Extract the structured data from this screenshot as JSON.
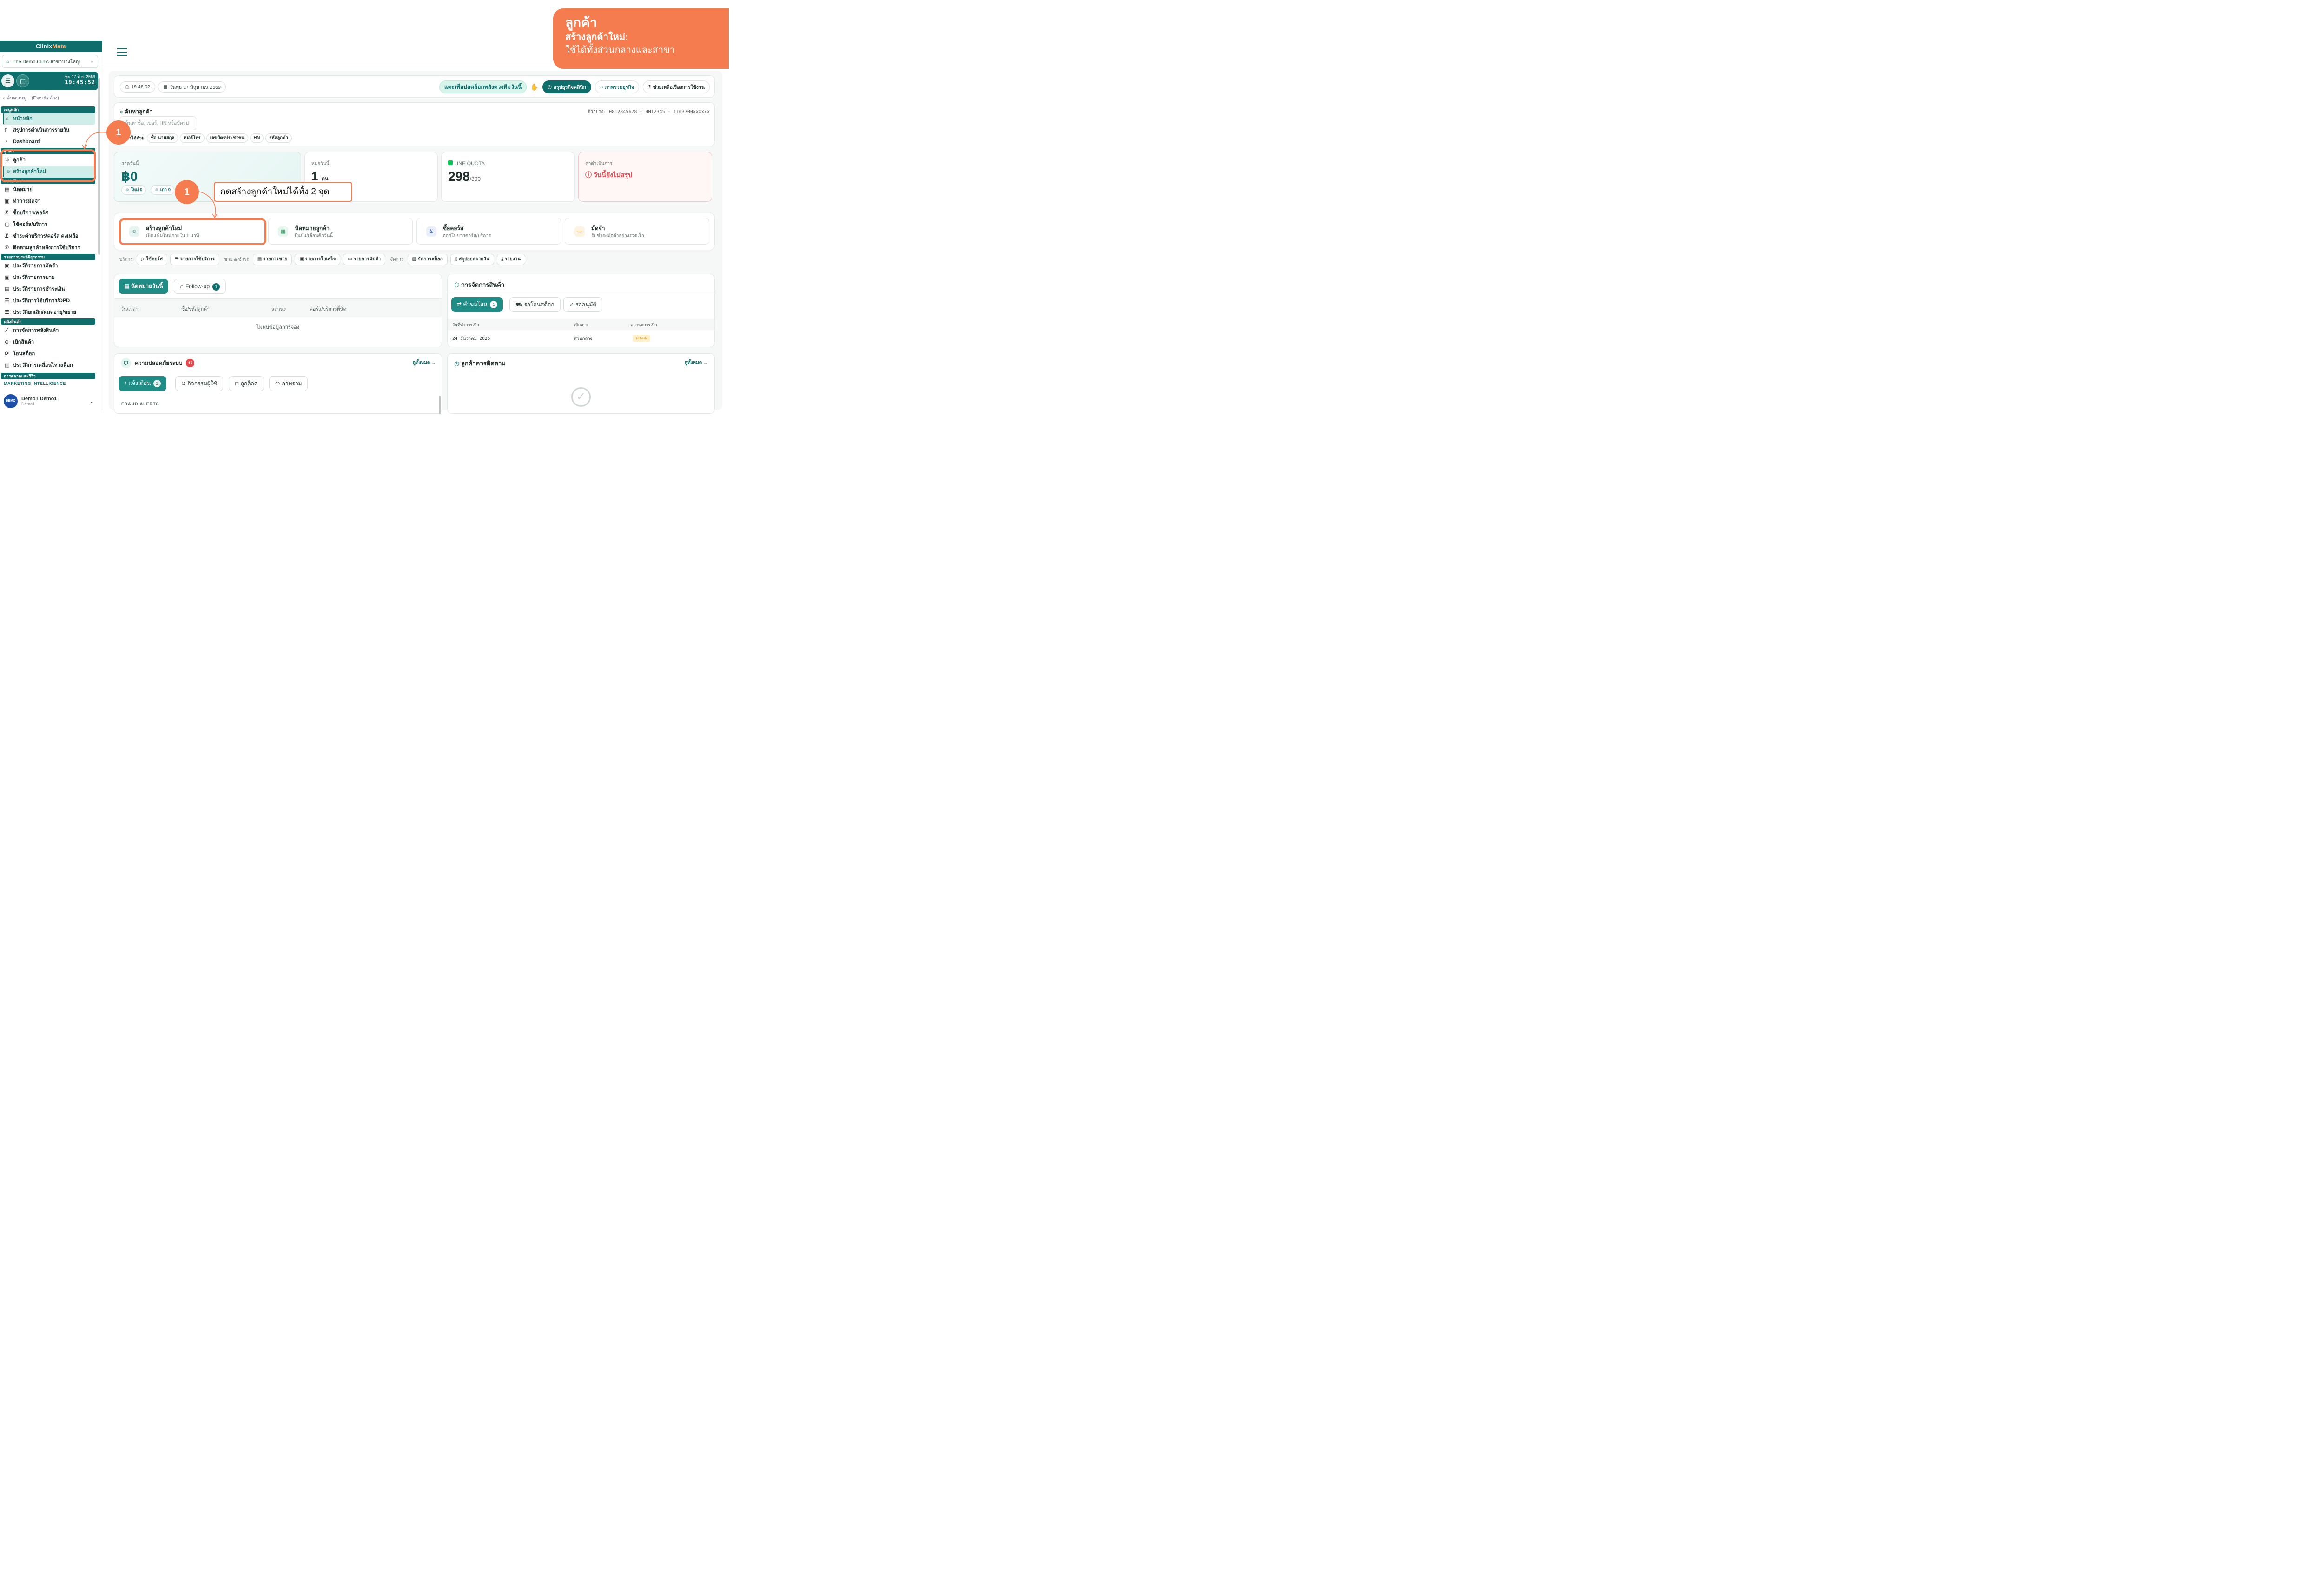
{
  "brand": {
    "part1": "Clinix",
    "part2": "Mate"
  },
  "clinic": {
    "name": "The Demo Clinic สาขาบางใหญ่"
  },
  "clock": {
    "date": "พุธ 17 มิ.ย. 2569",
    "time": "19:45:52"
  },
  "menu_search": {
    "placeholder": "ค้นหาเมนู... (Esc เพื่อล้าง)"
  },
  "sidebar": {
    "sections": {
      "main": "เมนูหลัก",
      "customer": "ลูกค้า",
      "service": "งานบริการ",
      "history": "รายการประวัติธุรกรรม",
      "stock": "คลังสินค้า",
      "marketing": "การตลาดและรีวิว",
      "intel": "MARKETING INTELLIGENCE"
    },
    "items": {
      "home": "หน้าหลัก",
      "daily_summary": "สรุปการดำเนินการรายวัน",
      "dashboard": "Dashboard",
      "customer": "ลูกค้า",
      "new_customer": "สร้างลูกค้าใหม่",
      "appointment": "นัดหมาย",
      "deposit": "ทำการมัดจำ",
      "buy_service": "ซื้อบริการ/คอร์ส",
      "use_course": "ใช้คอร์ส/บริการ",
      "pay_remaining": "ชำระค่าบริการ/คอร์ส คงเหลือ",
      "follow_up": "ติดตามลูกค้าหลังการใช้บริการ",
      "hist_deposit": "ประวัติรายการมัดจำ",
      "hist_sales": "ประวัติรายการขาย",
      "hist_payment": "ประวัติรายการชำระเงิน",
      "hist_opd": "ประวัติการใช้บริการ/OPD",
      "hist_cancel": "ประวัติยกเลิก/หมดอายุ/ขยาย",
      "stock_manage": "การจัดการคลังสินค้า",
      "withdraw": "เบิกสินค้า",
      "transfer": "โอนสต็อก",
      "stock_history": "ประวัติการเคลื่อนไหวสต็อก"
    }
  },
  "user": {
    "name": "Demo1 Demo1",
    "sub": "Demo1",
    "avatar": "DEMO"
  },
  "callout": {
    "title": "ลูกค้า",
    "subtitle": "สร้างลูกค้าใหม่:",
    "desc": "ใช้ได้ทั้งส่วนกลางและสาขา"
  },
  "topbar": {
    "time": "19:46:02",
    "date": "วันพุธ 17 มิถุนายน 2569",
    "energy": "แตะเพื่อปลดล็อกพลังดวงทีมวันนี้",
    "summary_btn": "สรุปธุรกิจคลินิก",
    "overview_btn": "ภาพรวมธุรกิจ",
    "help_btn": "ช่วยเหลือเรื่องการใช้งาน"
  },
  "customer_search": {
    "title": "ค้นหาลูกค้า",
    "example": "ตัวอย่าง: 0812345678 · HN12345 · 1103700xxxxxx",
    "placeholder": "ค้นหาชื่อ, เบอร์, HN หรือบัตรป",
    "by_label": "ค้นหาได้ด้วย",
    "chips": [
      "ชื่อ-นามสกุล",
      "เบอร์โทร",
      "เลขบัตรประชาชน",
      "HN",
      "รหัสลูกค้า"
    ]
  },
  "stats": {
    "sales_label": "ยอดวันนี้",
    "sales_value": "฿0",
    "new_label": "ใหม่",
    "new_value": "0",
    "old_label": "เก่า",
    "old_value": "0",
    "doctor_label": "หมอวันนี้",
    "doctor_value": "1",
    "doctor_unit": "คน",
    "line_label": "LINE QUOTA",
    "line_value": "298",
    "line_max": "/300",
    "expense_label": "ค่าดำเนินการ",
    "expense_value": "วันนี้ยังไม่สรุป"
  },
  "quick_actions": [
    {
      "title": "สร้างลูกค้าใหม่",
      "sub": "เปิดแฟ้มใหม่ภายใน 1 นาที"
    },
    {
      "title": "นัดหมายลูกค้า",
      "sub": "ยืนยัน/เลื่อนคิววันนี้"
    },
    {
      "title": "ซื้อคอร์ส",
      "sub": "ออกใบขายคอร์ส/บริการ"
    },
    {
      "title": "มัดจำ",
      "sub": "รับชำระมัดจำอย่างรวดเร็ว"
    }
  ],
  "service_bar": {
    "label_service": "บริการ",
    "use_course": "ใช้คอร์ส",
    "service_list": "รายการใช้บริการ",
    "label_sell": "ขาย & ชำระ",
    "sales_list": "รายการขาย",
    "receipt_list": "รายการใบเสร็จ",
    "deposit_list": "รายการมัดจำ",
    "label_manage": "จัดการ",
    "stock_manage": "จัดการสต็อก",
    "daily_summary": "สรุปยอดรายวัน",
    "report": "รายงาน"
  },
  "appointments": {
    "tab_today": "นัดหมายวันนี้",
    "tab_follow": "Follow-up",
    "follow_count": "1",
    "cols": [
      "วัน/เวลา",
      "ชื่อ/รหัสลูกค้า",
      "สถานะ",
      "คอร์ส/บริการที่นัด"
    ],
    "empty": "ไม่พบข้อมูลการจอง"
  },
  "product": {
    "title": "การจัดการสินค้า",
    "tab_request": "คำขอโอน",
    "request_count": "1",
    "tab_wait": "รอโอนสต็อก",
    "tab_approve": "รออนุมัติ",
    "cols": [
      "วันที่ทำการเบิก",
      "เบิกจาก",
      "สถานะการเบิก"
    ],
    "row": {
      "date": "24 ธันวาคม 2025",
      "from": "ส่วนกลาง",
      "status": "รอจัดส่ง"
    }
  },
  "security": {
    "title": "ความปลอดภัยระบบ",
    "count": "12",
    "see_all": "ดูทั้งหมด →",
    "tabs": {
      "alert": "แจ้งเตือน",
      "alert_count": "2",
      "activity": "กิจกรรมผู้ใช้",
      "locked": "ถูกล็อค",
      "overview": "ภาพรวม"
    },
    "fraud": "FRAUD ALERTS"
  },
  "followup": {
    "title": "ลูกค้าควรติดตาม",
    "see_all": "ดูทั้งหมด →"
  },
  "annotation": {
    "marker": "1",
    "tooltip": "กดสร้างลูกค้าใหม่ได้ทั้ง 2 จุด"
  },
  "colors": {
    "brand": "#0f6e6b",
    "accent": "#f47c4f",
    "danger": "#e5484d"
  }
}
